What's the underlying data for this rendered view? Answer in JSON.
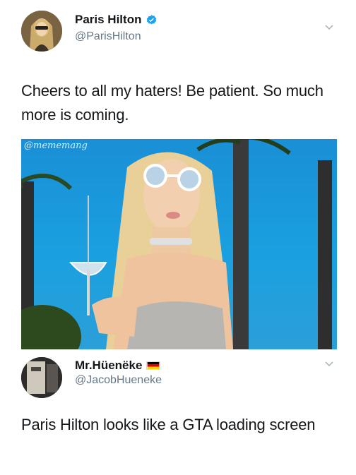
{
  "tweets": [
    {
      "display_name": "Paris Hilton",
      "handle": "@ParisHilton",
      "verified": true,
      "text": "Cheers to all my haters! Be patient. So much more is coming.",
      "media": {
        "watermark": "@mememang"
      }
    },
    {
      "display_name": "Mr.Hüenëke",
      "handle": "@JacobHueneke",
      "flag": "germany",
      "text": "Paris Hilton looks like a GTA loading screen"
    }
  ],
  "colors": {
    "verified_badge": "#1da1f2",
    "handle_gray": "#657786",
    "sky_blue": "#1a9ad9"
  }
}
